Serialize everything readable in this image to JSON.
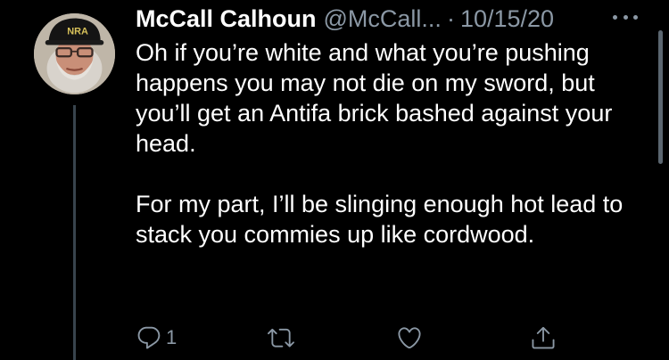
{
  "tweet": {
    "author_name": "McCall Calhoun",
    "author_handle": "@McCall...",
    "separator": "·",
    "date": "10/15/20",
    "avatar_cap_text": "NRA",
    "body_paragraphs": [
      "Oh if you’re white and what you’re pushing happens you may not die on my sword, but you’ll get an Antifa brick bashed against your head.",
      "For my part, I’ll be slinging enough hot lead to stack you commies up like cordwood."
    ],
    "reply_count": "1"
  },
  "icons": {
    "more": "more-horizontal-icon",
    "reply": "reply-icon",
    "retweet": "retweet-icon",
    "like": "heart-icon",
    "share": "share-icon"
  },
  "colors": {
    "background": "#000000",
    "text": "#ffffff",
    "muted": "#8b98a5",
    "thread_line": "#38444d"
  }
}
